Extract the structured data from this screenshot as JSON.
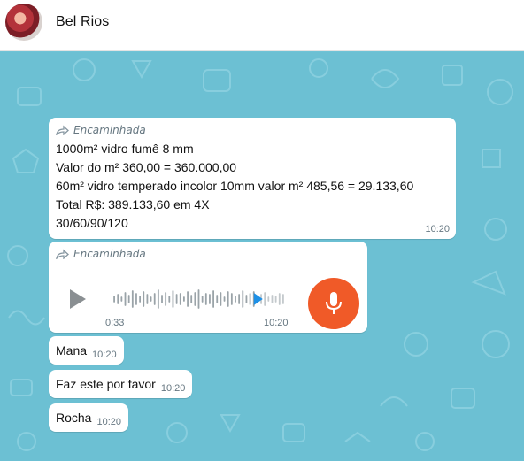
{
  "header": {
    "contact_name": "Bel Rios"
  },
  "messages": [
    {
      "forwarded_label": "Encaminhada",
      "lines": [
        "1000m² vidro fumê 8 mm",
        "Valor do m² 360,00 = 360.000,00",
        "60m² vidro temperado incolor 10mm valor m² 485,56 = 29.133,60",
        "Total R$: 389.133,60 em 4X",
        "30/60/90/120"
      ],
      "time": "10:20"
    },
    {
      "forwarded_label": "Encaminhada",
      "audio_duration": "0:33",
      "audio_progress": 0.84,
      "time": "10:20"
    },
    {
      "text": "Mana",
      "time": "10:20"
    },
    {
      "text": "Faz este por favor",
      "time": "10:20"
    },
    {
      "text": "Rocha",
      "time": "10:20"
    }
  ],
  "colors": {
    "wallpaper": "#6cc0d3",
    "bubble": "#ffffff",
    "mic_button": "#f05a28",
    "wave_played": "#1e90e6",
    "wave_unplayed": "#9aa3a8"
  },
  "icons": {
    "forward": "forward-arrow-icon",
    "play": "play-icon",
    "mic": "microphone-icon"
  }
}
